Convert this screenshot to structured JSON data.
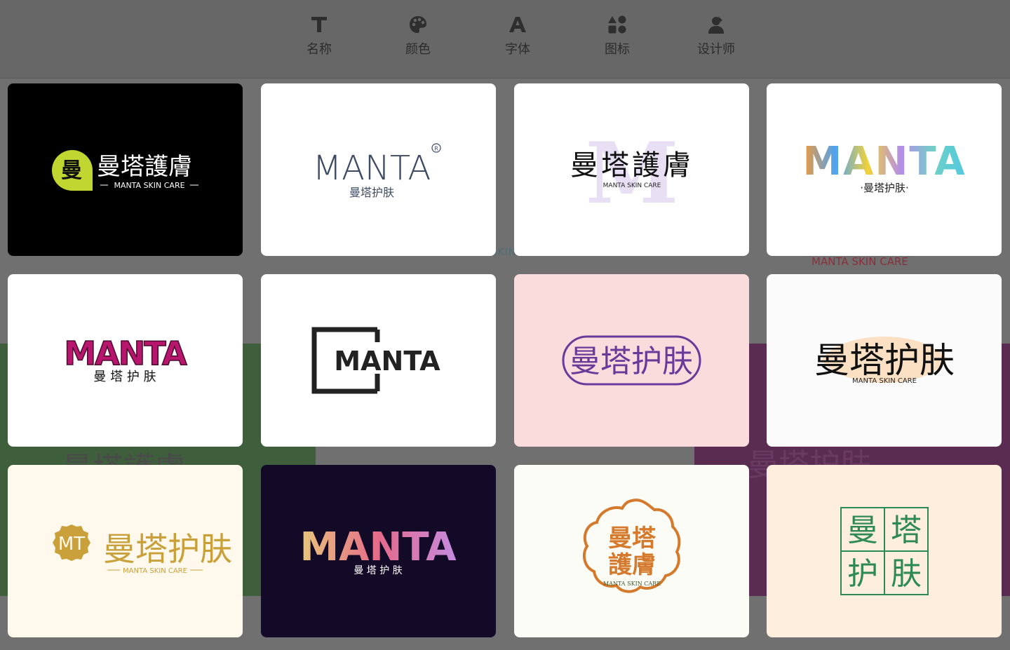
{
  "toolbar": {
    "items": [
      {
        "label": "名称",
        "icon": "text-t-icon"
      },
      {
        "label": "颜色",
        "icon": "palette-icon"
      },
      {
        "label": "字体",
        "icon": "font-a-icon"
      },
      {
        "label": "图标",
        "icon": "shapes-icon"
      },
      {
        "label": "设计师",
        "icon": "designer-icon"
      }
    ]
  },
  "background": {
    "teal_caption": "MANTA SKIN CARE",
    "red_caption": "MANTA SKIN CARE"
  },
  "cards": [
    {
      "brand_cn": "曼塔護膚",
      "badge": "曼",
      "tagline": "MANTA SKIN CARE",
      "bg": "#000000",
      "accent": "#bfd730"
    },
    {
      "brand_en": "MANTA",
      "brand_cn": "曼塔护肤",
      "mark": "R",
      "bg": "#ffffff",
      "accent": "#3c4a63"
    },
    {
      "brand_cn": "曼塔護膚",
      "bg_letter": "M",
      "tagline": "MANTA SKIN CARE",
      "bg": "#ffffff",
      "accent": "#e8dff5"
    },
    {
      "brand_en": "MANTA",
      "brand_cn": "·曼塔护肤·",
      "bg": "#ffffff"
    },
    {
      "brand_en": "MANTA",
      "brand_cn": "曼 塔 护 肤",
      "bg": "#ffffff",
      "accent": "#b8156e"
    },
    {
      "brand_en": "MANTA",
      "bg": "#ffffff",
      "accent": "#222222"
    },
    {
      "brand_cn": "曼塔护肤",
      "bg": "#fadcdd",
      "accent": "#6a3a9a"
    },
    {
      "brand_cn": "曼塔护肤",
      "tagline": "MANTA SKIN CARE",
      "bg": "#fbfbfc",
      "accent": "#fbe0c4"
    },
    {
      "badge": "MT",
      "brand_cn": "曼塔护肤",
      "tagline": "MANTA SKIN CARE",
      "bg": "#fef9ec",
      "accent": "#c9a03a"
    },
    {
      "brand_en": "MANTA",
      "brand_cn": "曼 塔 护 肤",
      "bg": "#120a26"
    },
    {
      "brand_cn_1": "曼塔",
      "brand_cn_2": "護膚",
      "tagline": "MANTA SKIN CARE",
      "bg": "#fbfcf6",
      "accent": "#d57a2c"
    },
    {
      "grid_cn": [
        "曼",
        "塔",
        "护",
        "肤"
      ],
      "bg": "#fdeedd",
      "accent": "#2e8a55"
    }
  ]
}
